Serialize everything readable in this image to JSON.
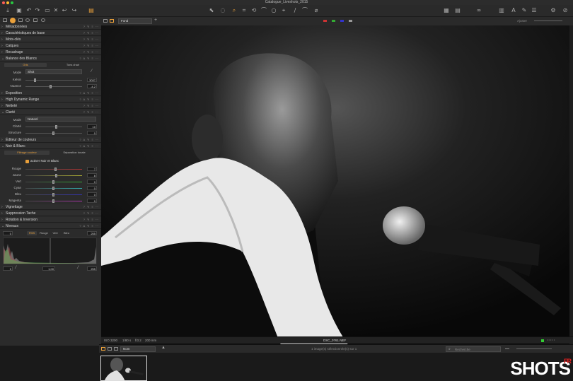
{
  "window": {
    "title": "Catalogue_Liveshots_2015"
  },
  "toolbar": {
    "left": [
      "⤓",
      "▣",
      "↶",
      "↷",
      "▭",
      "✕",
      "↩",
      "↪",
      "▤"
    ],
    "tools": [
      "⬉",
      "◌",
      "⌕",
      "⌗",
      "⟲",
      "⌒",
      "○",
      "⌖",
      "∕",
      "⌒",
      "⌀"
    ],
    "right": [
      "▦",
      "▤",
      "∞",
      "▥",
      "A",
      "✎",
      "☰",
      "⚙",
      "⊘"
    ]
  },
  "panel": {
    "sections": [
      {
        "label": "Métadonnées",
        "open": false
      },
      {
        "label": "Caractéristiques de base",
        "open": false
      },
      {
        "label": "Mots-clés",
        "open": false
      },
      {
        "label": "Calques",
        "open": false
      },
      {
        "label": "Recadrage",
        "open": false
      },
      {
        "label": "Balance des Blancs",
        "open": true
      }
    ],
    "wb": {
      "tabs": [
        "Gris",
        "Tons chair"
      ],
      "mode_label": "Mode",
      "mode_value": "Shot",
      "kelvin_label": "Kelvin",
      "kelvin_value": "3037",
      "nuance_label": "Nuance",
      "nuance_value": "-4,2"
    },
    "sections2": [
      {
        "label": "Exposition"
      },
      {
        "label": "High Dynamic Range"
      },
      {
        "label": "Netteté"
      }
    ],
    "clarte": {
      "label": "Clarté",
      "mode_label": "Mode",
      "mode_value": "Naturel",
      "clarte_label": "Clarté",
      "clarte_value": "10",
      "structure_label": "Structure",
      "structure_value": "0"
    },
    "sections3": [
      {
        "label": "Éditeur de couleurs"
      }
    ],
    "nb": {
      "label": "Noir & Blanc",
      "tabs": [
        "Filtrage couleur",
        "Séparation tonale"
      ],
      "enable_label": "activer Noir et Blanc",
      "channels": [
        {
          "name": "Rouge",
          "value": "7"
        },
        {
          "name": "Jaune",
          "value": "8"
        },
        {
          "name": "Vert",
          "value": "0"
        },
        {
          "name": "Cyan",
          "value": "0"
        },
        {
          "name": "Bleu",
          "value": "0"
        },
        {
          "name": "Magenta",
          "value": "0"
        }
      ]
    },
    "sections4": [
      {
        "label": "Vignettage"
      },
      {
        "label": "Suppression Tache"
      },
      {
        "label": "Rotation & Inversion"
      }
    ],
    "niveaux": {
      "label": "Niveaux",
      "in_low": "0",
      "in_high": "255",
      "channel_tabs": [
        "RVB",
        "Rouge",
        "Vert",
        "Bleu"
      ],
      "mid": "1,00",
      "out_low": "0",
      "out_high": "255"
    }
  },
  "viewer": {
    "layer": "Fond",
    "zoom_label": "Ajuster",
    "info": {
      "iso": "ISO 3200",
      "shutter": "1/80 s",
      "aperture": "f/3.2",
      "focal": "200 mm",
      "filename": "DSC_0761.NEF"
    }
  },
  "browser": {
    "sort": "Nom",
    "selection": "1 image(s) sélectionnée(s) sur 1",
    "search_placeholder": "Recherche"
  },
  "logo": {
    "text": "SHOTS",
    "sup": "FR"
  }
}
